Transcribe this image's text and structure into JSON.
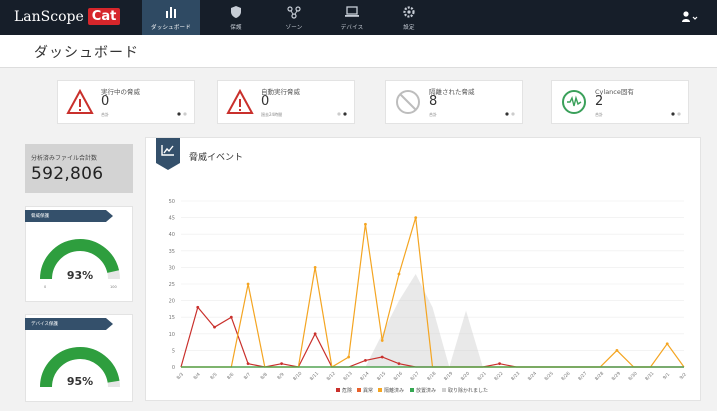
{
  "app": {
    "brand_text": "LanScope",
    "brand_cat": "Cat"
  },
  "nav": [
    {
      "label": "ダッシュボード",
      "icon": "bar-chart-icon"
    },
    {
      "label": "保護",
      "icon": "shield-icon"
    },
    {
      "label": "ゾーン",
      "icon": "network-icon"
    },
    {
      "label": "デバイス",
      "icon": "laptop-icon"
    },
    {
      "label": "設定",
      "icon": "gear-icon"
    }
  ],
  "header": {
    "title": "ダッシュボード"
  },
  "cards": [
    {
      "title": "実行中の脅威",
      "value": "0",
      "sub": "合計",
      "icon": "warning-icon",
      "color": "#c9302c"
    },
    {
      "title": "自動実行脅威",
      "value": "0",
      "sub": "過去24時間",
      "icon": "warning-icon",
      "color": "#c9302c"
    },
    {
      "title": "隔離された脅威",
      "value": "8",
      "sub": "合計",
      "icon": "blocked-icon",
      "color": "#bdbdbd"
    },
    {
      "title": "Cylance固有",
      "value": "2",
      "sub": "合計",
      "icon": "cylance-icon",
      "color": "#3aa05a"
    }
  ],
  "files": {
    "label": "分析済みファイル合計数",
    "value": "592,806"
  },
  "gauges": [
    {
      "label": "脅威保護",
      "value": "93%",
      "fraction": 0.93,
      "min": "0",
      "max": "100"
    },
    {
      "label": "デバイス保護",
      "value": "95%",
      "fraction": 0.95,
      "min": "0",
      "max": "100"
    }
  ],
  "colors": {
    "nav_bg": "#161e29",
    "nav_active": "#2f4a63",
    "gauge_green": "#2e9e3e",
    "danger": "#c9302c",
    "unsafe": "#e8612c",
    "quarantined": "#f4a522",
    "whitelisted": "#35a852",
    "removed": "#cfcfcf"
  },
  "chart_data": {
    "type": "line",
    "title": "脅威イベント",
    "categories": [
      "8/3",
      "8/4",
      "8/5",
      "8/6",
      "8/7",
      "8/8",
      "8/9",
      "8/10",
      "8/11",
      "8/12",
      "8/13",
      "8/14",
      "8/15",
      "8/16",
      "8/17",
      "8/18",
      "8/19",
      "8/20",
      "8/21",
      "8/22",
      "8/23",
      "8/24",
      "8/25",
      "8/26",
      "8/27",
      "8/28",
      "8/29",
      "8/30",
      "8/31",
      "9/1",
      "9/2"
    ],
    "ylim": [
      0,
      50
    ],
    "yticks": [
      "0",
      "5",
      "10",
      "15",
      "20",
      "25",
      "30",
      "35",
      "40",
      "45",
      "50"
    ],
    "grid": true,
    "legend_position": "bottom-center",
    "series": [
      {
        "name": "危険",
        "color": "#c9302c",
        "values": [
          0,
          18,
          12,
          15,
          1,
          0,
          1,
          0,
          10,
          0,
          0,
          2,
          3,
          1,
          0,
          0,
          0,
          0,
          0,
          1,
          0,
          0,
          0,
          0,
          0,
          0,
          0,
          0,
          0,
          0,
          0
        ]
      },
      {
        "name": "異常",
        "color": "#e8612c",
        "values": [
          0,
          0,
          0,
          0,
          0,
          0,
          0,
          0,
          0,
          0,
          0,
          0,
          0,
          0,
          0,
          0,
          0,
          0,
          0,
          0,
          0,
          0,
          0,
          0,
          0,
          0,
          0,
          0,
          0,
          0,
          0
        ]
      },
      {
        "name": "隔離済み",
        "color": "#f4a522",
        "values": [
          0,
          0,
          0,
          0,
          25,
          0,
          0,
          0,
          30,
          0,
          3,
          43,
          8,
          28,
          45,
          0,
          0,
          0,
          0,
          0,
          0,
          0,
          0,
          0,
          0,
          0,
          5,
          0,
          0,
          7,
          0
        ]
      },
      {
        "name": "放置済み",
        "color": "#35a852",
        "values": [
          0,
          0,
          0,
          0,
          0,
          0,
          0,
          0,
          0,
          0,
          0,
          0,
          0,
          0,
          0,
          0,
          0,
          0,
          0,
          0,
          0,
          0,
          0,
          0,
          0,
          0,
          0,
          0,
          0,
          0,
          0
        ]
      },
      {
        "name": "取り除かれました",
        "color": "#cfcfcf",
        "values": [
          0,
          0,
          0,
          0,
          0,
          0,
          0,
          0,
          0,
          0,
          0,
          0,
          10,
          20,
          28,
          18,
          0,
          17,
          0,
          0,
          0,
          0,
          0,
          0,
          0,
          0,
          0,
          0,
          0,
          0,
          0
        ]
      }
    ]
  }
}
